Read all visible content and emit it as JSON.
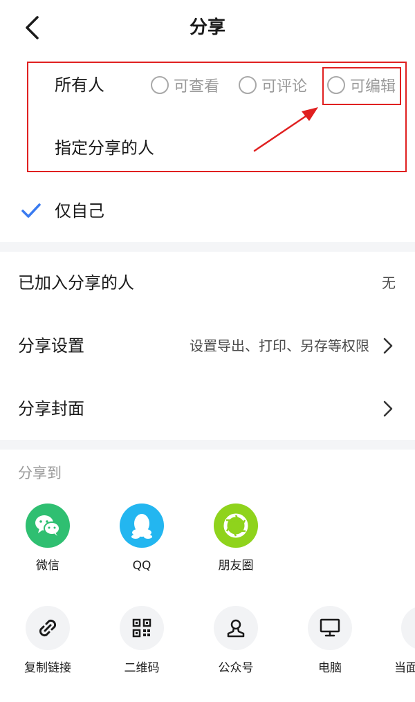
{
  "header": {
    "title": "分享"
  },
  "permissions": {
    "everyone_label": "所有人",
    "options": [
      "可查看",
      "可评论",
      "可编辑"
    ],
    "specific_label": "指定分享的人",
    "only_me_label": "仅自己"
  },
  "settings": {
    "joined_label": "已加入分享的人",
    "joined_value": "无",
    "share_settings_label": "分享设置",
    "share_settings_value": "设置导出、打印、另存等权限",
    "cover_label": "分享封面"
  },
  "share_to": {
    "label": "分享到",
    "apps": [
      {
        "label": "微信",
        "icon": "wechat-icon",
        "color": "#2fbf71"
      },
      {
        "label": "QQ",
        "icon": "qq-icon",
        "color": "#23b6f0"
      },
      {
        "label": "朋友圈",
        "icon": "moments-icon",
        "color": "#8fd31c"
      }
    ],
    "tools": [
      {
        "label": "复制链接",
        "icon": "link-icon"
      },
      {
        "label": "二维码",
        "icon": "qrcode-icon"
      },
      {
        "label": "公众号",
        "icon": "official-account-icon"
      },
      {
        "label": "电脑",
        "icon": "computer-icon"
      },
      {
        "label": "当面",
        "icon": "face-to-face-icon"
      }
    ]
  },
  "colors": {
    "highlight": "#e02020",
    "accent_check": "#3a7bf0",
    "divider": "#f4f5f7"
  }
}
